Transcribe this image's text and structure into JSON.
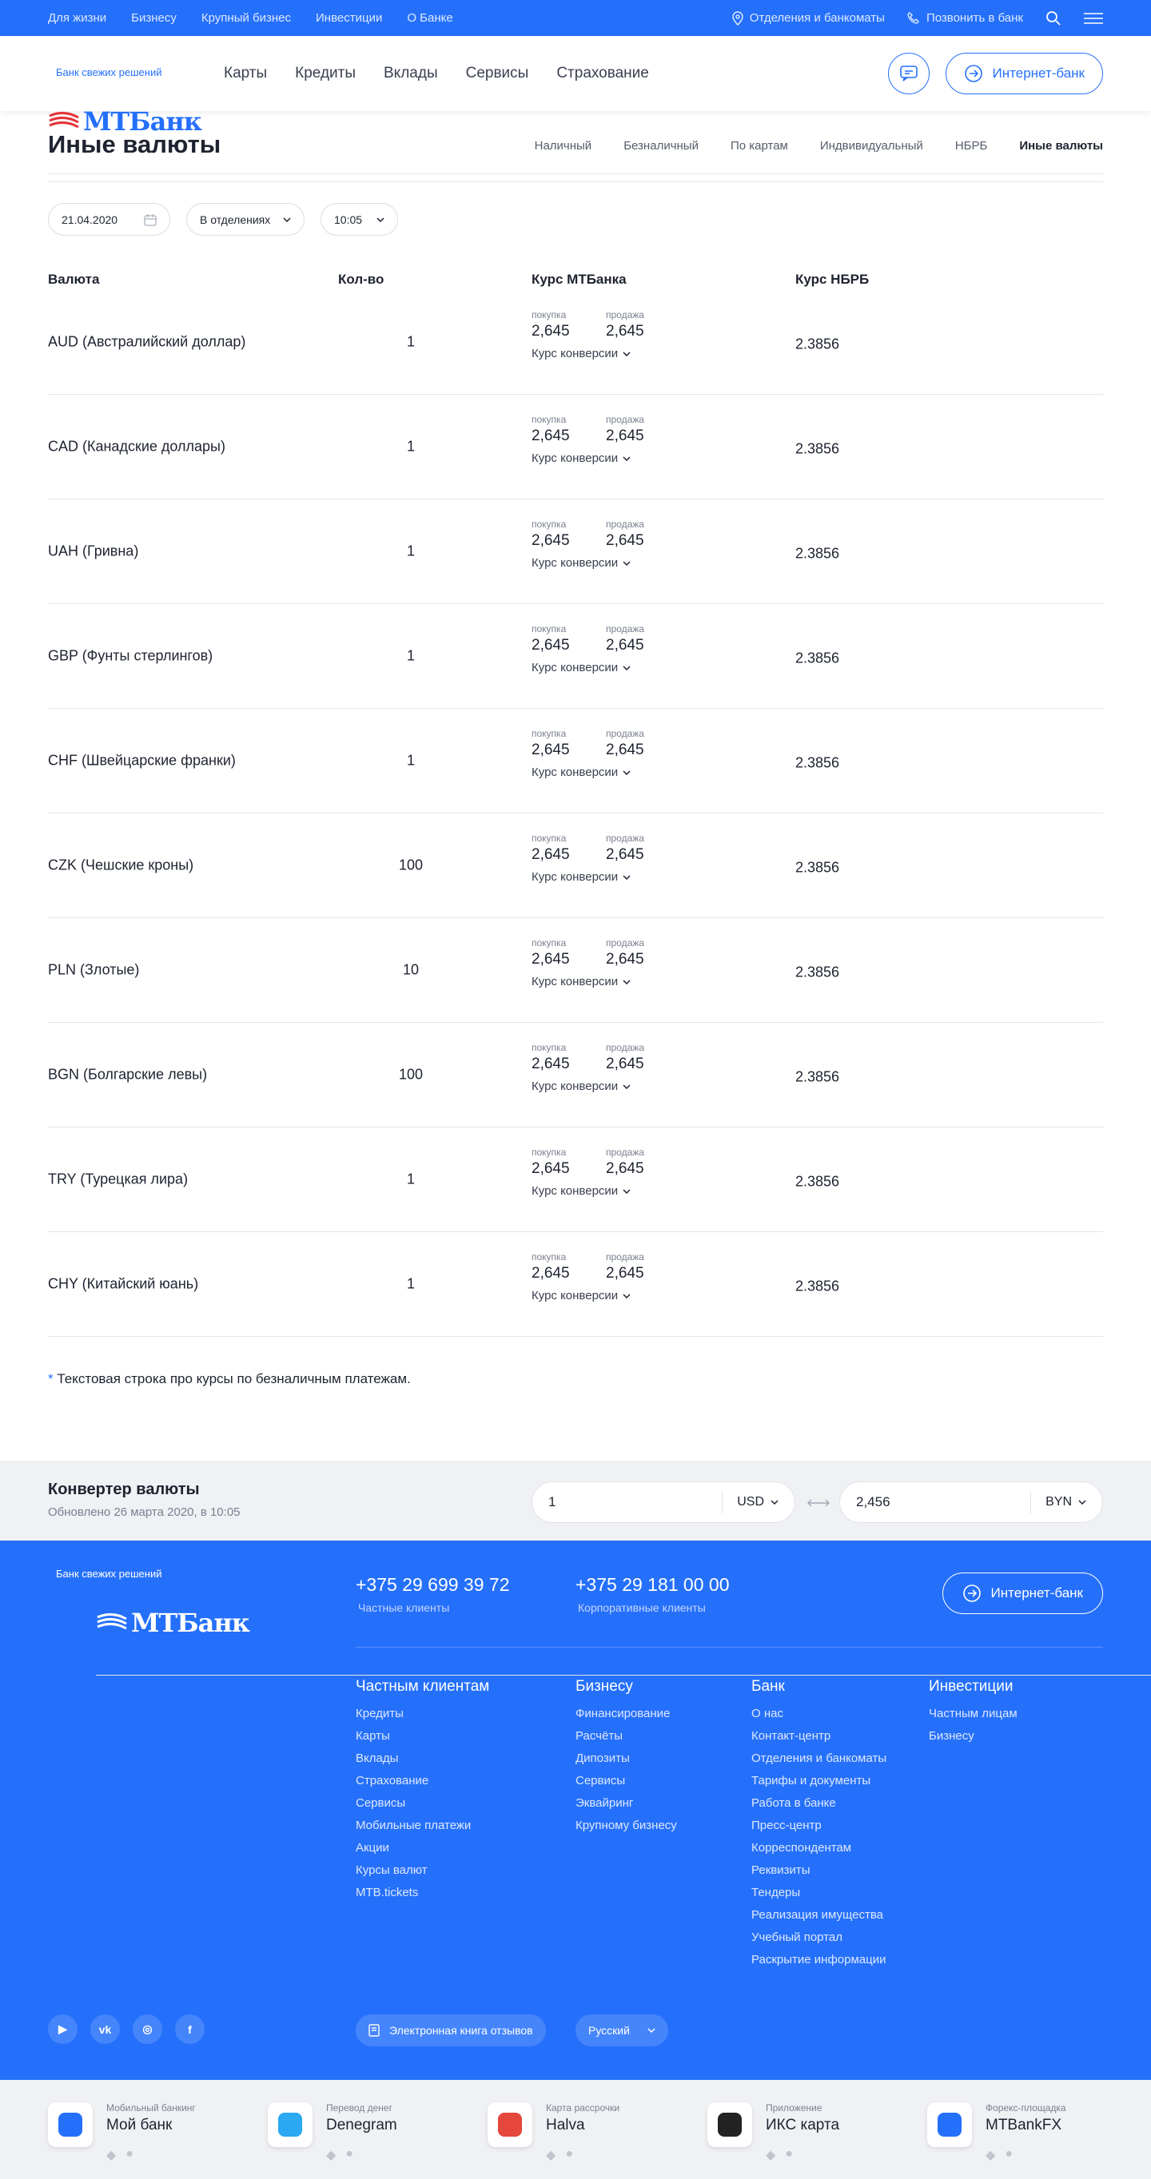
{
  "topbar": {
    "links": [
      "Для жизни",
      "Бизнесу",
      "Крупный бизнес",
      "Инвестиции",
      "О Банке"
    ],
    "branches": "Отделения и банкоматы",
    "call": "Позвонить в банк"
  },
  "header": {
    "logo": "МТБанк",
    "tagline": "Банк свежих решений",
    "nav": [
      "Карты",
      "Кредиты",
      "Вклады",
      "Сервисы",
      "Страхование"
    ],
    "ibank": "Интернет-банк"
  },
  "page": {
    "title": "Иные валюты",
    "tabs": [
      "Наличный",
      "Безналичный",
      "По картам",
      "Индвивидуальный",
      "НБРБ",
      "Иные валюты"
    ]
  },
  "filters": {
    "date": "21.04.2020",
    "place": "В отделениях",
    "time": "10:05"
  },
  "table": {
    "headers": [
      "Валюта",
      "Кол-во",
      "Курс МТБанка",
      "Курс НБРБ"
    ],
    "buy_label": "покупка",
    "sell_label": "продажа",
    "conv_label": "Курс конверсии",
    "rows": [
      {
        "currency": "AUD (Австралийский доллар)",
        "qty": "1",
        "buy": "2,645",
        "sell": "2,645",
        "nbrb": "2.3856"
      },
      {
        "currency": "CAD (Канадские доллары)",
        "qty": "1",
        "buy": "2,645",
        "sell": "2,645",
        "nbrb": "2.3856"
      },
      {
        "currency": "UAH (Гривна)",
        "qty": "1",
        "buy": "2,645",
        "sell": "2,645",
        "nbrb": "2.3856"
      },
      {
        "currency": "GBP (Фунты стерлингов)",
        "qty": "1",
        "buy": "2,645",
        "sell": "2,645",
        "nbrb": "2.3856"
      },
      {
        "currency": "CHF (Швейцарские франки)",
        "qty": "1",
        "buy": "2,645",
        "sell": "2,645",
        "nbrb": "2.3856"
      },
      {
        "currency": "CZK (Чешские кроны)",
        "qty": "100",
        "buy": "2,645",
        "sell": "2,645",
        "nbrb": "2.3856"
      },
      {
        "currency": "PLN (Злотые)",
        "qty": "10",
        "buy": "2,645",
        "sell": "2,645",
        "nbrb": "2.3856"
      },
      {
        "currency": "BGN (Болгарские левы)",
        "qty": "100",
        "buy": "2,645",
        "sell": "2,645",
        "nbrb": "2.3856"
      },
      {
        "currency": "TRY (Турецкая лира)",
        "qty": "1",
        "buy": "2,645",
        "sell": "2,645",
        "nbrb": "2.3856"
      },
      {
        "currency": "CHY (Китайский юань)",
        "qty": "1",
        "buy": "2,645",
        "sell": "2,645",
        "nbrb": "2.3856"
      }
    ]
  },
  "note": {
    "star": "*",
    "text": "Текстовая строка про курсы по безналичным платежам."
  },
  "converter": {
    "title": "Конвертер валюты",
    "updated": "Обновлено 26 марта 2020, в 10:05",
    "from_value": "1",
    "from_cur": "USD",
    "to_value": "2,456",
    "to_cur": "BYN"
  },
  "footer": {
    "logo": "МТБанк",
    "tagline": "Банк свежих решений",
    "phone1": "+375 29 699 39 72",
    "phone1_label": "Частные клиенты",
    "phone2": "+375 29 181 00 00",
    "phone2_label": "Корпоративные клиенты",
    "ibank": "Интернет-банк",
    "columns": [
      {
        "title": "Частным клиентам",
        "items": [
          "Кредиты",
          "Карты",
          "Вклады",
          "Страхование",
          "Сервисы",
          "Мобильные платежи",
          "Акции",
          "Курсы валют",
          "MTB.tickets"
        ]
      },
      {
        "title": "Бизнесу",
        "items": [
          "Финансирование",
          "Расчёты",
          "Дипозиты",
          "Сервисы",
          "Эквайринг",
          "Крупному бизнесу"
        ]
      },
      {
        "title": "Банк",
        "items": [
          "О нас",
          "Контакт-центр",
          "Отделения и банкоматы",
          "Тарифы и документы",
          "Работа в банке",
          "Пресс-центр",
          "Корреспондентам",
          "Реквизиты",
          "Тендеры",
          "Реализация имущества",
          "Учебный портал",
          "Раскрытие информации"
        ]
      },
      {
        "title": "Инвестиции",
        "items": [
          "Частным лицам",
          "Бизнесу"
        ]
      }
    ],
    "reviews": "Электронная книга отзывов",
    "lang": "Русский"
  },
  "apps": [
    {
      "small": "Мобильный банкинг",
      "name": "Мой банк",
      "color": "#2570fb"
    },
    {
      "small": "Перевод денег",
      "name": "Denegram",
      "color": "#2aa8f2"
    },
    {
      "small": "Карта рассрочки",
      "name": "Halva",
      "color": "#e5473c"
    },
    {
      "small": "Приложение",
      "name": "ИКС карта",
      "color": "#222222"
    },
    {
      "small": "Форекс-площадка",
      "name": "MTBankFX",
      "color": "#2570fb"
    }
  ]
}
